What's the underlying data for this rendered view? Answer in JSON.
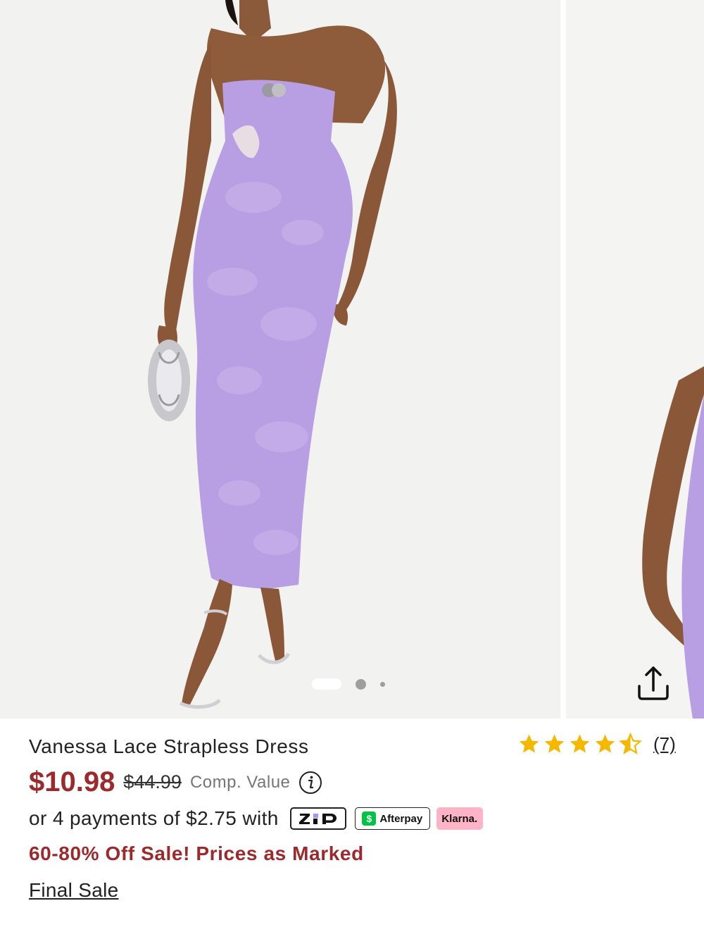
{
  "product": {
    "title": "Vanessa Lace Strapless Dress",
    "sale_price": "$10.98",
    "original_price": "$44.99",
    "comp_value_label": "Comp. Value",
    "rating": 4.5,
    "review_count": "(7)",
    "sale_message": "60-80% Off Sale! Prices as Marked",
    "final_sale_label": "Final Sale"
  },
  "payments": {
    "text": "or 4 payments of $2.75 with",
    "zip_label": "ZIP",
    "afterpay_label": "Afterpay",
    "afterpay_icon_label": "$",
    "klarna_label": "Klarna."
  },
  "gallery": {
    "image_count": 3,
    "active_index": 0
  },
  "icons": {
    "share": "share-icon",
    "info": "info-icon",
    "star": "star-icon",
    "half_star": "half-star-icon"
  },
  "colors": {
    "sale_red": "#9c2a2c",
    "star_yellow": "#f5b800",
    "dress_lavender": "#b89ee3",
    "klarna_pink": "#ffb3c7",
    "afterpay_green": "#00c244"
  }
}
